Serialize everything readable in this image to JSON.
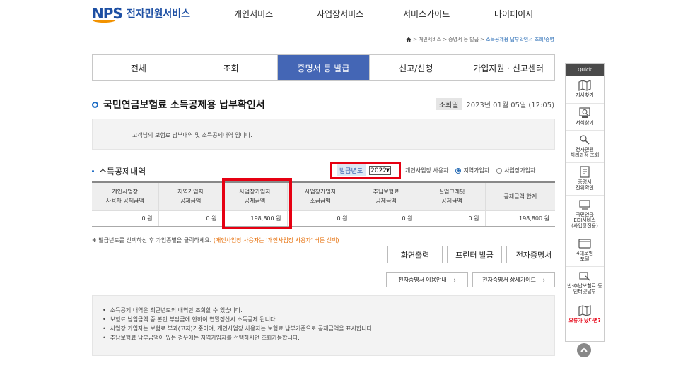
{
  "header": {
    "logo_mark": "NPS",
    "logo_text": "전자민원서비스",
    "nav": [
      "개인서비스",
      "사업장서비스",
      "서비스가이드",
      "마이페이지"
    ]
  },
  "breadcrumb": {
    "items": [
      "개인서비스",
      "증명서 등 발급"
    ],
    "current": "소득공제용 납부확인서 조회/증명"
  },
  "tabs": [
    {
      "label": "전체",
      "active": false
    },
    {
      "label": "조회",
      "active": false
    },
    {
      "label": "증명서 등 발급",
      "active": true
    },
    {
      "label": "신고/신청",
      "active": false
    },
    {
      "label": "가입지원 · 신고센터",
      "active": false
    }
  ],
  "page": {
    "title": "국민연금보험료 소득공제용 납부확인서",
    "query_date_label": "조회일",
    "query_date": "2023년 01월 05일 (12:05)",
    "info_text": "고객님의 보험료 납부내역 및 소득공제내역 입니다."
  },
  "section": {
    "title": "소득공제내역",
    "year_label": "발급년도",
    "year_value": "2022",
    "radio_prefix": "개인사업장 사용자",
    "radios": [
      {
        "label": "지역가입자",
        "checked": true
      },
      {
        "label": "사업장가입자",
        "checked": false
      }
    ]
  },
  "table": {
    "headers": [
      [
        "개인사업장",
        "사용자 공제금액"
      ],
      [
        "지역가입자",
        "공제금액"
      ],
      [
        "사업장가입자",
        "공제금액"
      ],
      [
        "사업장가입자",
        "소급금액"
      ],
      [
        "추납보험료",
        "공제금액"
      ],
      [
        "실업크레딧",
        "공제금액"
      ],
      [
        "공제금액 합계",
        ""
      ]
    ],
    "row": [
      "0 원",
      "0 원",
      "198,800 원",
      "0 원",
      "0 원",
      "0 원",
      "198,800 원"
    ]
  },
  "note": {
    "text": "※ 발급년도를 선택하신 후 가입종별을 클릭하세요.",
    "highlight": "(개인사업장 사용자는 '개인사업장 사용자' 버튼 선택)"
  },
  "buttons": {
    "screen_print": "화면출력",
    "printer_issue": "프린터 발급",
    "e_cert": "전자증명서",
    "e_cert_guide": "전자증명서 이용안내",
    "e_cert_detail": "전자증명서 상세가이드"
  },
  "notices": [
    "소득공제 내역은 최근년도의 내역만 조회할 수 있습니다.",
    "보험료 납입금액 중 본인 부담금에 한하여 연말정산시 소득공제 됩니다.",
    "사업장 가입자는 보험료 부과(고지)기준이며, 개인사업장 사용자는 보험료 납부기준으로 공제금액을 표시합니다.",
    "추납보험료 납부금액이 있는 경우에는 지역가입자를 선택하시면 조회가능합니다."
  ],
  "quick": {
    "title": "Quick",
    "items": [
      {
        "label": "지사찾기",
        "icon": "map-icon"
      },
      {
        "label": "서식찾기",
        "icon": "form-search-icon"
      },
      {
        "label": "전자민원\n처리과정 조회",
        "icon": "process-search-icon"
      },
      {
        "label": "증명서\n진위확인",
        "icon": "certificate-icon"
      },
      {
        "label": "국민연금\nEDI서비스\n(사업장전용)",
        "icon": "edi-icon"
      },
      {
        "label": "4대보험\n포털",
        "icon": "portal-icon"
      },
      {
        "label": "반·추납보험료 등\n인터넷납부",
        "icon": "payment-icon"
      },
      {
        "label": "오류가 났다면?",
        "icon": "error-map-icon"
      }
    ]
  }
}
